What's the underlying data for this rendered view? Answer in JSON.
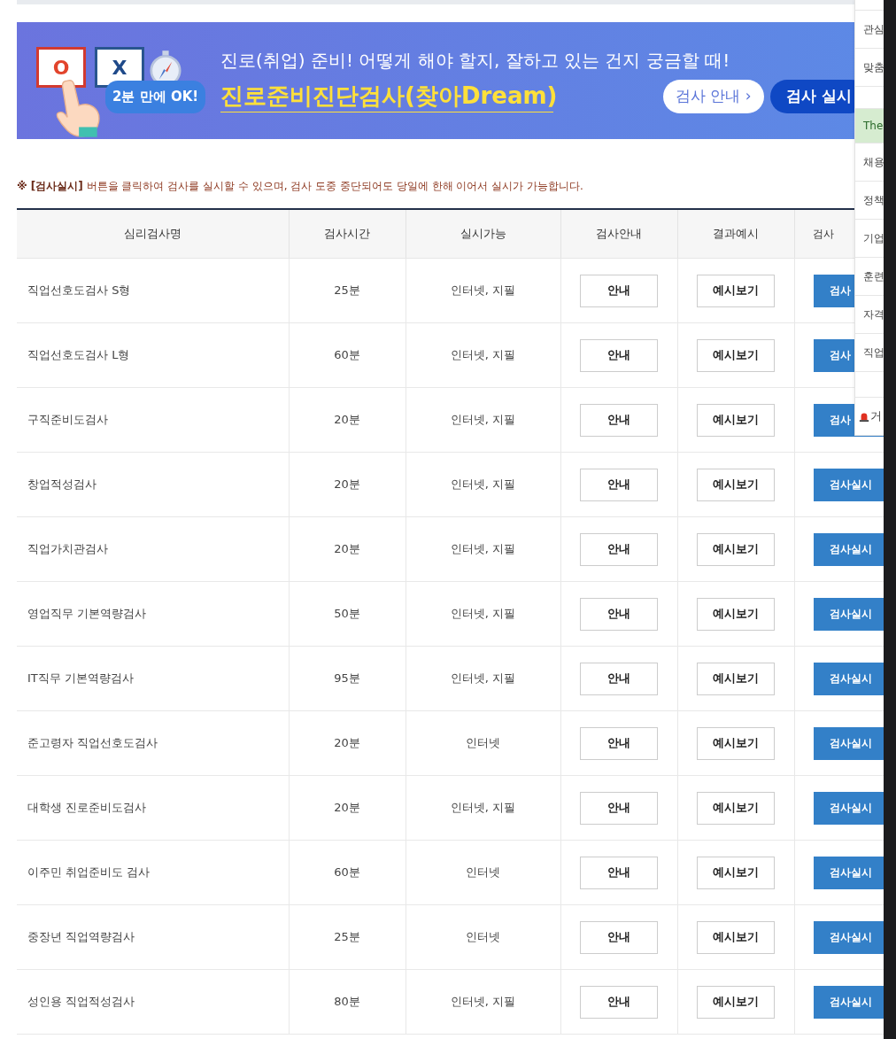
{
  "banner": {
    "card_o": "O",
    "card_x": "X",
    "bubble": "2분 만에 OK!",
    "headline": "진로(취업) 준비! 어떻게 해야 할지, 잘하고 있는 건지 궁금할 때!",
    "title": "진로준비진단검사(찾아Dream)",
    "guide_button": "검사 안내 ›",
    "start_button": "검사 실시"
  },
  "notice": "**※ [검사실시]** 버튼을 클릭하여 검사를 실시할 수 있으며, 검사 도중 중단되어도 당일에 한해 이어서 실시가 가능합니다.",
  "table": {
    "columns": [
      "심리검사명",
      "검사시간",
      "실시가능",
      "검사안내",
      "결과예시",
      "검사"
    ],
    "rows": [
      {
        "name": "직업선호도검사 S형",
        "time": "25분",
        "available": "인터넷, 지필",
        "guide": "안내",
        "example": "예시보기",
        "run": "검사"
      },
      {
        "name": "직업선호도검사 L형",
        "time": "60분",
        "available": "인터넷, 지필",
        "guide": "안내",
        "example": "예시보기",
        "run": "검사"
      },
      {
        "name": "구직준비도검사",
        "time": "20분",
        "available": "인터넷, 지필",
        "guide": "안내",
        "example": "예시보기",
        "run": "검사"
      },
      {
        "name": "창업적성검사",
        "time": "20분",
        "available": "인터넷, 지필",
        "guide": "안내",
        "example": "예시보기",
        "run": "검사실시"
      },
      {
        "name": "직업가치관검사",
        "time": "20분",
        "available": "인터넷, 지필",
        "guide": "안내",
        "example": "예시보기",
        "run": "검사실시"
      },
      {
        "name": "영업직무 기본역량검사",
        "time": "50분",
        "available": "인터넷, 지필",
        "guide": "안내",
        "example": "예시보기",
        "run": "검사실시"
      },
      {
        "name": "IT직무 기본역량검사",
        "time": "95분",
        "available": "인터넷, 지필",
        "guide": "안내",
        "example": "예시보기",
        "run": "검사실시"
      },
      {
        "name": "준고령자 직업선호도검사",
        "time": "20분",
        "available": "인터넷",
        "guide": "안내",
        "example": "예시보기",
        "run": "검사실시"
      },
      {
        "name": "대학생 진로준비도검사",
        "time": "20분",
        "available": "인터넷, 지필",
        "guide": "안내",
        "example": "예시보기",
        "run": "검사실시"
      },
      {
        "name": "이주민 취업준비도 검사",
        "time": "60분",
        "available": "인터넷",
        "guide": "안내",
        "example": "예시보기",
        "run": "검사실시"
      },
      {
        "name": "중장년 직업역량검사",
        "time": "25분",
        "available": "인터넷",
        "guide": "안내",
        "example": "예시보기",
        "run": "검사실시"
      },
      {
        "name": "성인용 직업적성검사",
        "time": "80분",
        "available": "인터넷, 지필",
        "guide": "안내",
        "example": "예시보기",
        "run": "검사실시"
      }
    ]
  },
  "sidebar": {
    "items": [
      {
        "kind": "link",
        "label": "관심"
      },
      {
        "kind": "link",
        "label": "맞춤"
      },
      {
        "kind": "promo",
        "label": "The"
      },
      {
        "kind": "link",
        "label": "채용"
      },
      {
        "kind": "link",
        "label": "정책"
      },
      {
        "kind": "link",
        "label": "기업"
      },
      {
        "kind": "link",
        "label": "훈련"
      },
      {
        "kind": "link",
        "label": "자격"
      },
      {
        "kind": "link",
        "label": "직업"
      },
      {
        "kind": "alert",
        "label": "거"
      }
    ]
  }
}
